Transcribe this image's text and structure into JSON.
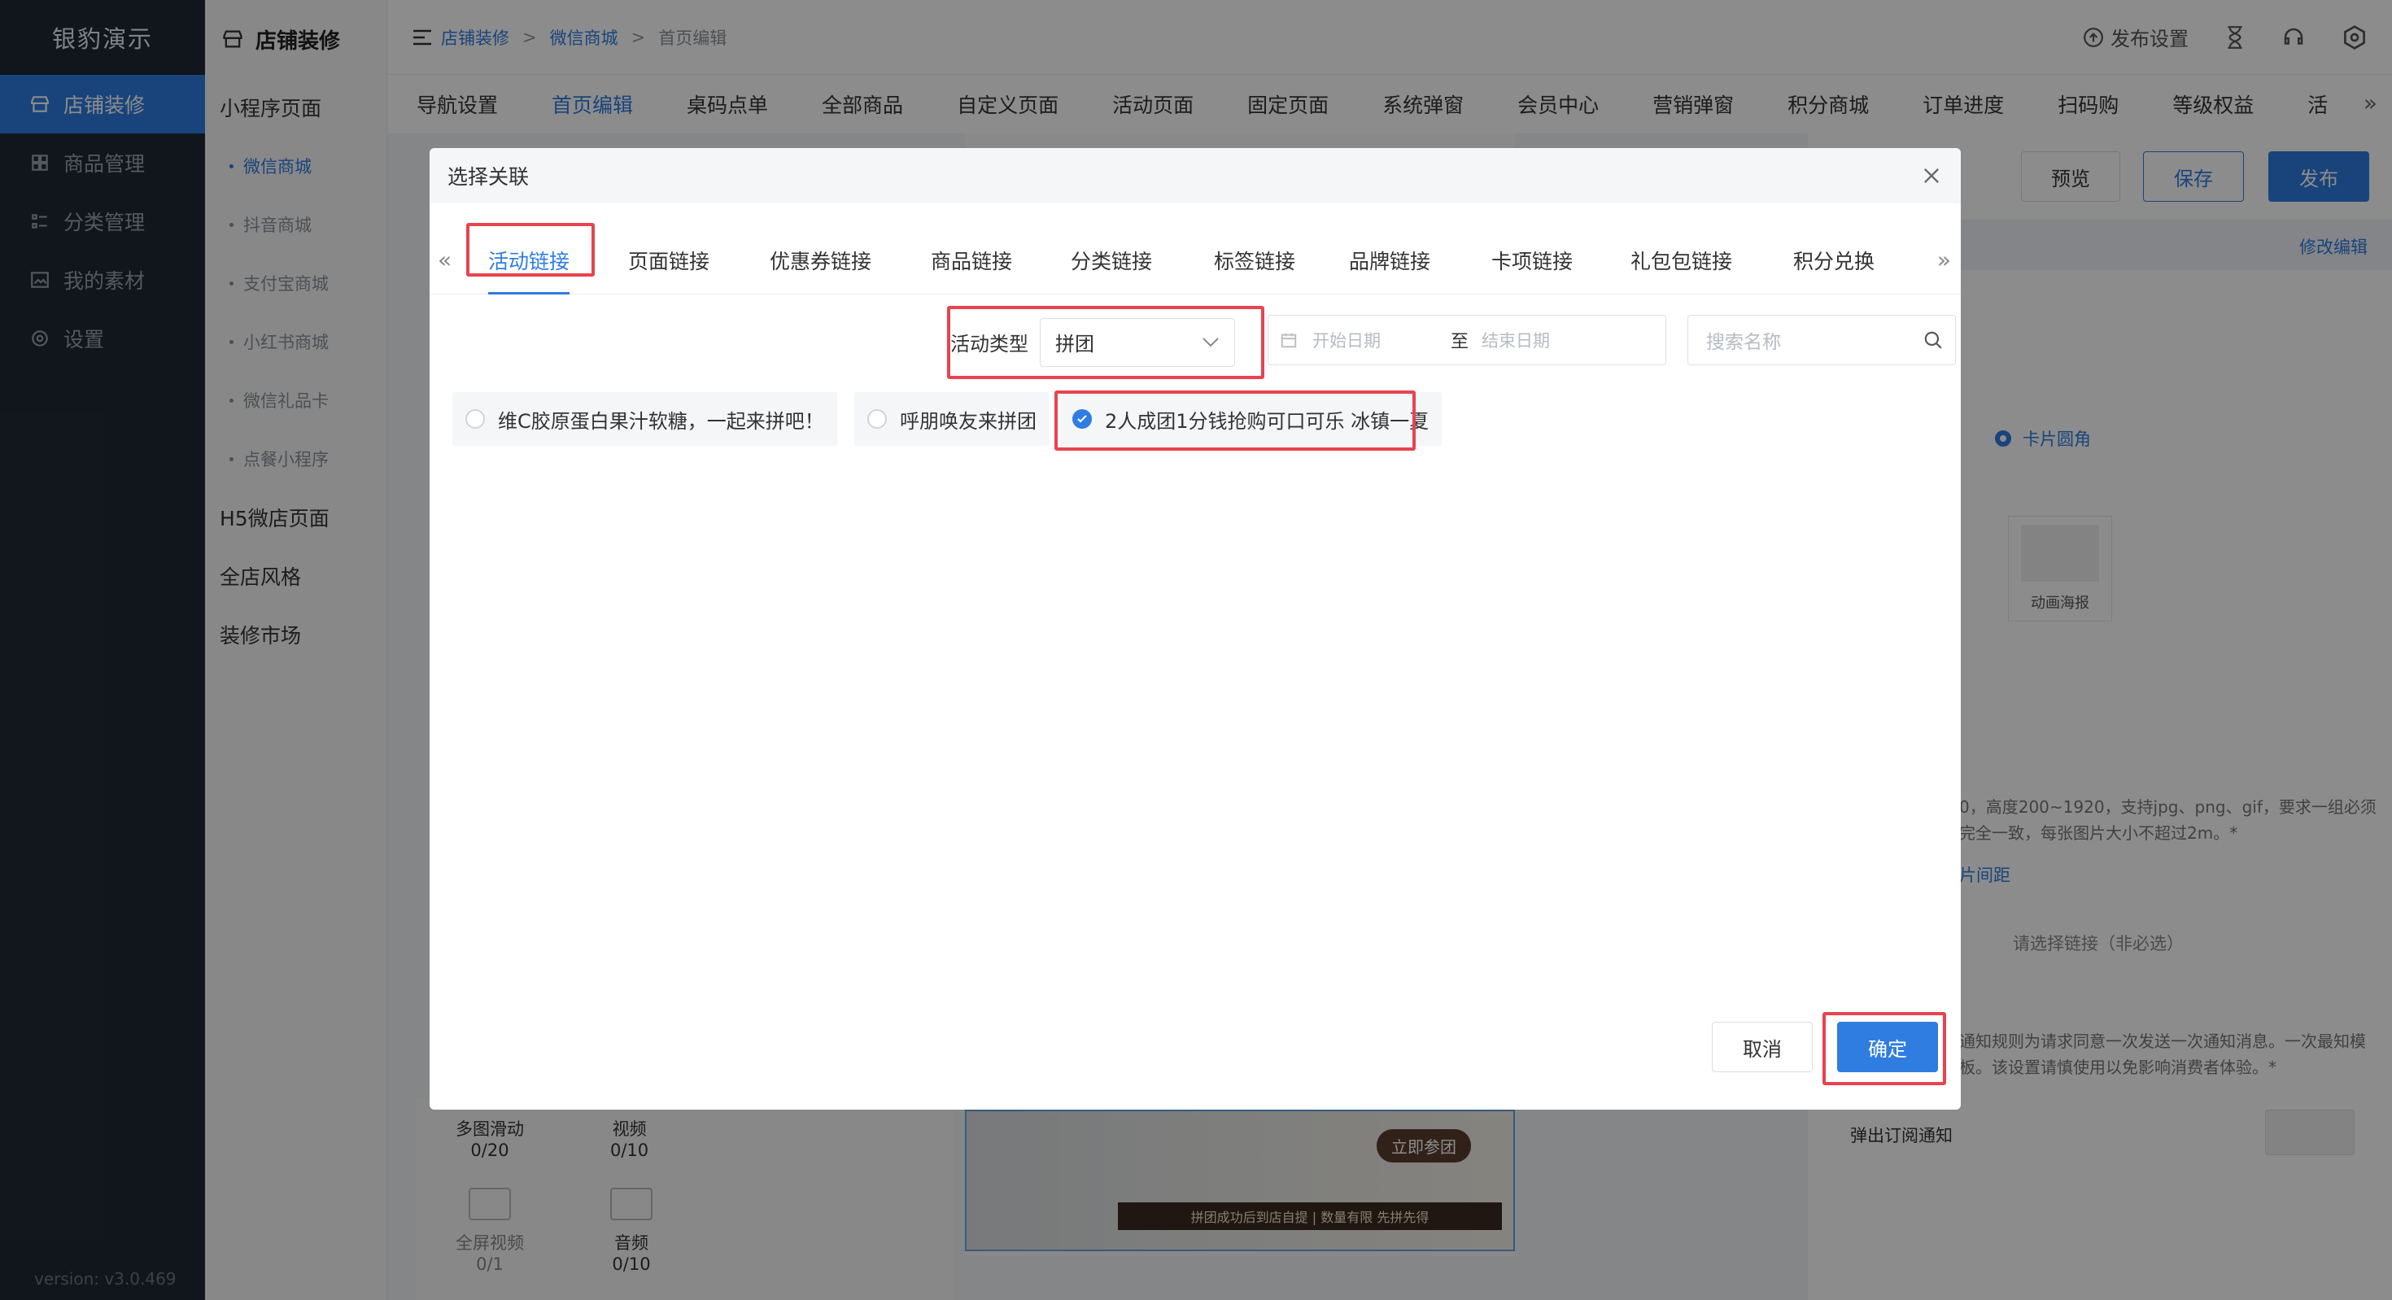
{
  "app": {
    "brand": "银豹演示",
    "version": "version: v3.0.469"
  },
  "sidebar": {
    "items": [
      {
        "label": "店铺装修",
        "icon": "store-icon",
        "active": true
      },
      {
        "label": "商品管理",
        "icon": "grid-icon"
      },
      {
        "label": "分类管理",
        "icon": "list-icon"
      },
      {
        "label": "我的素材",
        "icon": "image-icon"
      },
      {
        "label": "设置",
        "icon": "gear-icon"
      }
    ]
  },
  "subnav": {
    "title": "店铺装修",
    "items": [
      {
        "label": "小程序页面",
        "type": "item"
      },
      {
        "label": "微信商城",
        "type": "child",
        "active": true
      },
      {
        "label": "抖音商城",
        "type": "child"
      },
      {
        "label": "支付宝商城",
        "type": "child"
      },
      {
        "label": "小红书商城",
        "type": "child"
      },
      {
        "label": "微信礼品卡",
        "type": "child"
      },
      {
        "label": "点餐小程序",
        "type": "child"
      },
      {
        "label": "H5微店页面",
        "type": "item"
      },
      {
        "label": "全店风格",
        "type": "item"
      },
      {
        "label": "装修市场",
        "type": "item"
      }
    ]
  },
  "breadcrumb": {
    "a": "店铺装修",
    "b": "微信商城",
    "c": "首页编辑"
  },
  "topbar": {
    "publish_settings": "发布设置"
  },
  "page_tabs": [
    "导航设置",
    "首页编辑",
    "桌码点单",
    "全部商品",
    "自定义页面",
    "活动页面",
    "固定页面",
    "系统弹窗",
    "会员中心",
    "营销弹窗",
    "积分商城",
    "订单进度",
    "扫码购",
    "等级权益",
    "活"
  ],
  "toolbar": {
    "preview": "预览",
    "save": "保存",
    "publish": "发布",
    "modify": "修改编辑"
  },
  "modal": {
    "title": "选择关联",
    "tabs": [
      "活动链接",
      "页面链接",
      "优惠券链接",
      "商品链接",
      "分类链接",
      "标签链接",
      "品牌链接",
      "卡项链接",
      "礼包包链接",
      "积分兑换"
    ],
    "filter": {
      "type_label": "活动类型",
      "type_value": "拼团",
      "start_placeholder": "开始日期",
      "to": "至",
      "end_placeholder": "结束日期",
      "search_placeholder": "搜索名称"
    },
    "options": [
      {
        "label": "维C胶原蛋白果汁软糖，一起来拼吧！",
        "checked": false
      },
      {
        "label": "呼朋唤友来拼团",
        "checked": false
      },
      {
        "label": "2人成团1分钱抢购可口可乐 冰镇一夏",
        "checked": true
      }
    ],
    "cancel": "取消",
    "confirm": "确定"
  },
  "background": {
    "card_corner": "卡片圆角",
    "anim_poster": "动画海报",
    "hint": "0，高度200~1920，支持jpg、png、gif，要求一组必须完全一致，每张图片大小不超过2m。*",
    "img_gap": "片间距",
    "link_placeholder": "请选择链接（非必选）",
    "notify_hint": "通知规则为请求同意一次发送一次通知消息。一次最知模板。该设置请慎使用以免影响消费者体验。*",
    "subscribe": "弹出订阅通知",
    "multi": "多图滑动",
    "multi_count": "0/20",
    "video": "视频",
    "video_count": "0/10",
    "fullscreen": "全屏视频",
    "fullscreen_count": "0/1",
    "audio": "音频",
    "audio_count": "0/10",
    "join": "立即参团",
    "banner": "拼团成功后到店自提 | 数量有限 先拼先得"
  }
}
